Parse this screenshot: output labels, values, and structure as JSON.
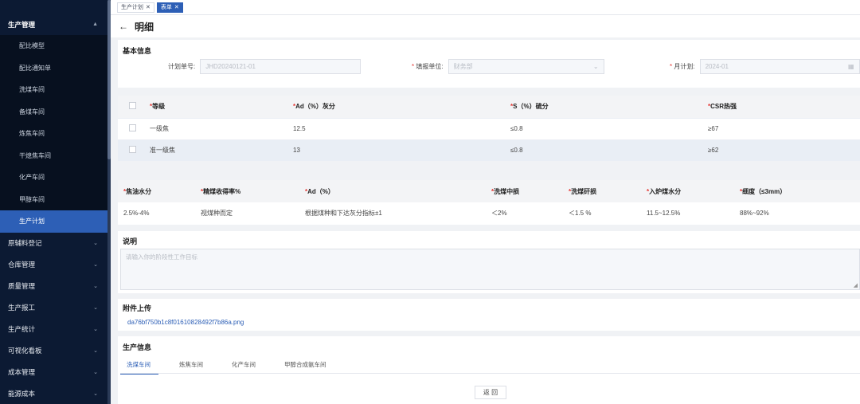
{
  "sidebar": {
    "open_group": "生产管理",
    "sub_items": [
      "配比模型",
      "配比通知单",
      "洗煤车间",
      "备煤车间",
      "炼焦车间",
      "干熄焦车间",
      "化产车间",
      "甲醇车间",
      "生产计划"
    ],
    "groups": [
      "原辅料登记",
      "仓库管理",
      "质量管理",
      "生产报工",
      "生产统计",
      "可视化看板",
      "成本管理",
      "能源成本"
    ]
  },
  "tabs": [
    {
      "label": "生产计划"
    },
    {
      "label": "表单"
    }
  ],
  "header": {
    "title": "明细"
  },
  "basic": {
    "title": "基本信息",
    "plan_no_label": "计划单号:",
    "plan_no_value": "JHD20240121-01",
    "unit_label": "填报单位:",
    "unit_value": "财务部",
    "month_label": "月计划:",
    "month_value": "2024-01"
  },
  "grade_table": {
    "headers": [
      "等级",
      "Ad（%）灰分",
      "S（%）硫分",
      "CSR热强"
    ],
    "rows": [
      [
        "一级焦",
        "12.5",
        "≤0.8",
        "≥67"
      ],
      [
        "准一级焦",
        "13",
        "≤0.8",
        "≥62"
      ]
    ]
  },
  "index_table": {
    "headers": [
      "焦油水分",
      "精煤收得率%",
      "Ad（%）",
      "洗煤中损",
      "洗煤矸损",
      "入炉煤水分",
      "细度（≤3mm）"
    ],
    "row": [
      "2.5%-4%",
      "视煤种而定",
      "根据煤种和下达灰分指标±1",
      "＜2%",
      "＜1.5 %",
      "11.5~12.5%",
      "88%~92%"
    ]
  },
  "desc": {
    "title": "说明",
    "placeholder": "请输入你的阶段性工作目标"
  },
  "attach": {
    "title": "附件上传",
    "file": "da76bf750b1c8f01610828492f7b86a.png"
  },
  "prod": {
    "title": "生产信息",
    "tabs": [
      "洗煤车间",
      "炼焦车间",
      "化产车间",
      "甲醇合成氨车间"
    ],
    "back_label": "返 回"
  },
  "colors": {
    "accent": "#2d5fb6",
    "sidebar_bg": "#0c1a33",
    "required": "#e53935"
  }
}
